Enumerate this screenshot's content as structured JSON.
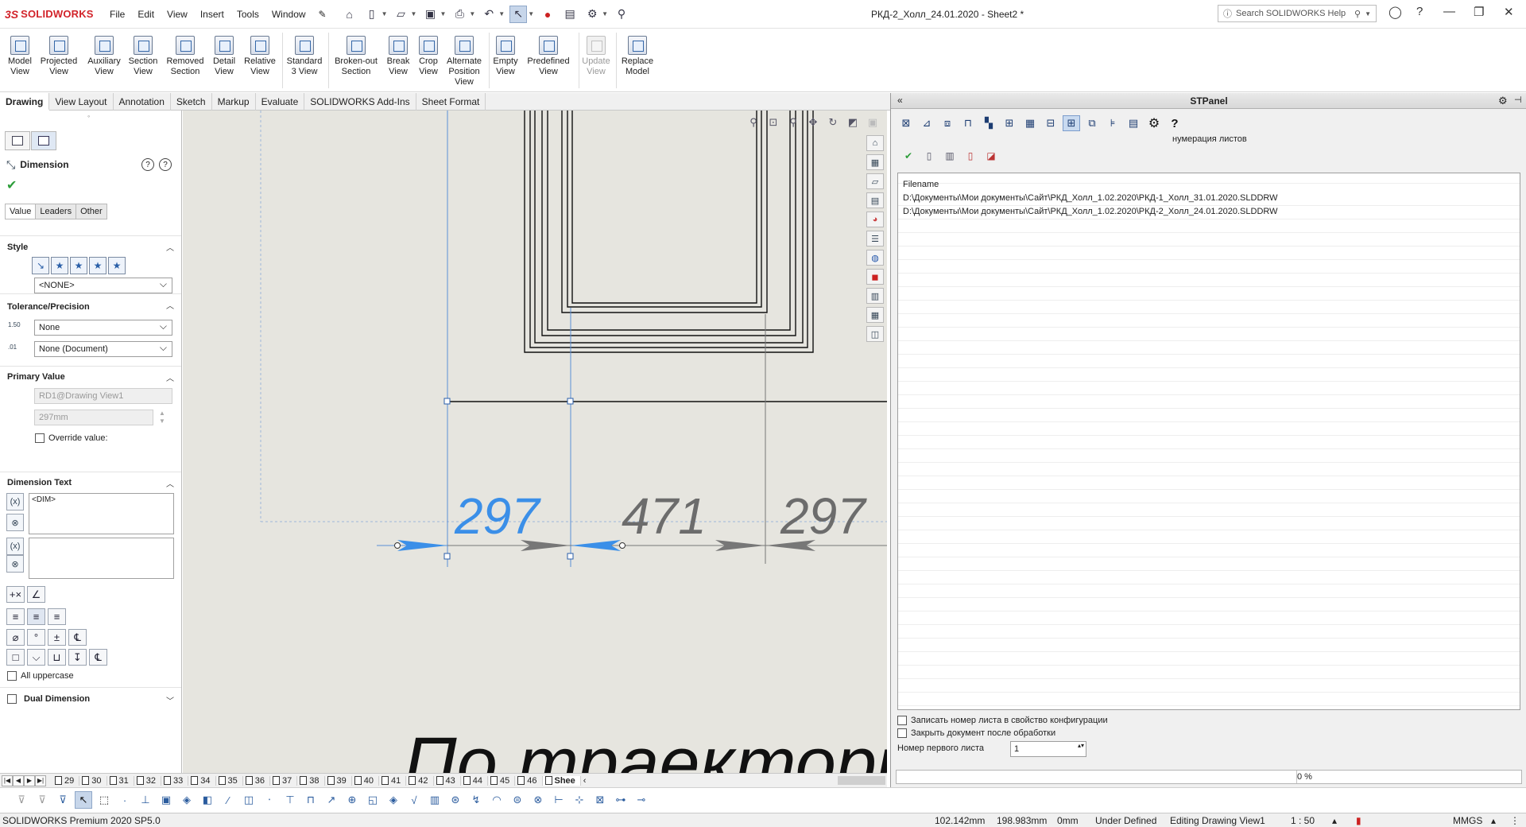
{
  "app": {
    "logo_ds": "3S",
    "logo_text": "SOLIDWORKS",
    "document_title": "РКД-2_Холл_24.01.2020 - Sheet2 *",
    "search_placeholder": "Search SOLIDWORKS Help"
  },
  "menu": [
    "File",
    "Edit",
    "View",
    "Insert",
    "Tools",
    "Window"
  ],
  "ribbon": [
    {
      "label": "Model\nView",
      "enabled": true
    },
    {
      "label": "Projected\nView",
      "enabled": true
    },
    {
      "label": "Auxiliary\nView",
      "enabled": true
    },
    {
      "label": "Section\nView",
      "enabled": true
    },
    {
      "label": "Removed\nSection",
      "enabled": true
    },
    {
      "label": "Detail\nView",
      "enabled": true
    },
    {
      "label": "Relative\nView",
      "enabled": true
    },
    {
      "label": "Standard\n3 View",
      "enabled": true
    },
    {
      "label": "Broken-out\nSection",
      "enabled": true
    },
    {
      "label": "Break\nView",
      "enabled": true
    },
    {
      "label": "Crop\nView",
      "enabled": true
    },
    {
      "label": "Alternate\nPosition\nView",
      "enabled": true
    },
    {
      "label": "Empty\nView",
      "enabled": true
    },
    {
      "label": "Predefined\nView",
      "enabled": true
    },
    {
      "label": "Update\nView",
      "enabled": false
    },
    {
      "label": "Replace\nModel",
      "enabled": true
    }
  ],
  "command_tabs": [
    "Drawing",
    "View Layout",
    "Annotation",
    "Sketch",
    "Markup",
    "Evaluate",
    "SOLIDWORKS Add-Ins",
    "Sheet Format"
  ],
  "property_manager": {
    "title": "Dimension",
    "tabs": [
      "Value",
      "Leaders",
      "Other"
    ],
    "style_group": "Style",
    "style_value": "<NONE>",
    "tolerance_group": "Tolerance/Precision",
    "tolerance_value": "None",
    "precision_value": "None (Document)",
    "primary_group": "Primary Value",
    "primary_ref": "RD1@Drawing View1",
    "primary_value": "297mm",
    "override_label": "Override value:",
    "dimtext_group": "Dimension Text",
    "dimtext_value": "<DIM>",
    "all_uppercase": "All uppercase",
    "dual_dimension": "Dual Dimension"
  },
  "drawing": {
    "dim1": "297",
    "dim2": "471",
    "dim3": "297",
    "big_text": "По траектори"
  },
  "stpanel": {
    "title": "STPanel",
    "subtitle": "нумерация листов",
    "list_header": "Filename",
    "files": [
      "D:\\Документы\\Мои документы\\Сайт\\РКД_Холл_1.02.2020\\РКД-1_Холл_31.01.2020.SLDDRW",
      "D:\\Документы\\Мои документы\\Сайт\\РКД_Холл_1.02.2020\\РКД-2_Холл_24.01.2020.SLDDRW"
    ],
    "option1": "Записать номер листа в свойство конфигурации",
    "option2": "Закрыть документ после обработки",
    "first_sheet_label": "Номер первого листа",
    "first_sheet_value": "1",
    "progress": "0 %"
  },
  "sheet_tabs": [
    "29",
    "30",
    "31",
    "32",
    "33",
    "34",
    "35",
    "36",
    "37",
    "38",
    "39",
    "40",
    "41",
    "42",
    "43",
    "44",
    "45",
    "46",
    "Shee"
  ],
  "status": {
    "version": "SOLIDWORKS Premium 2020 SP5.0",
    "x": "102.142mm",
    "y": "198.983mm",
    "z": "0mm",
    "state": "Under Defined",
    "editing": "Editing Drawing View1",
    "scale": "1 : 50",
    "units": "MMGS"
  }
}
